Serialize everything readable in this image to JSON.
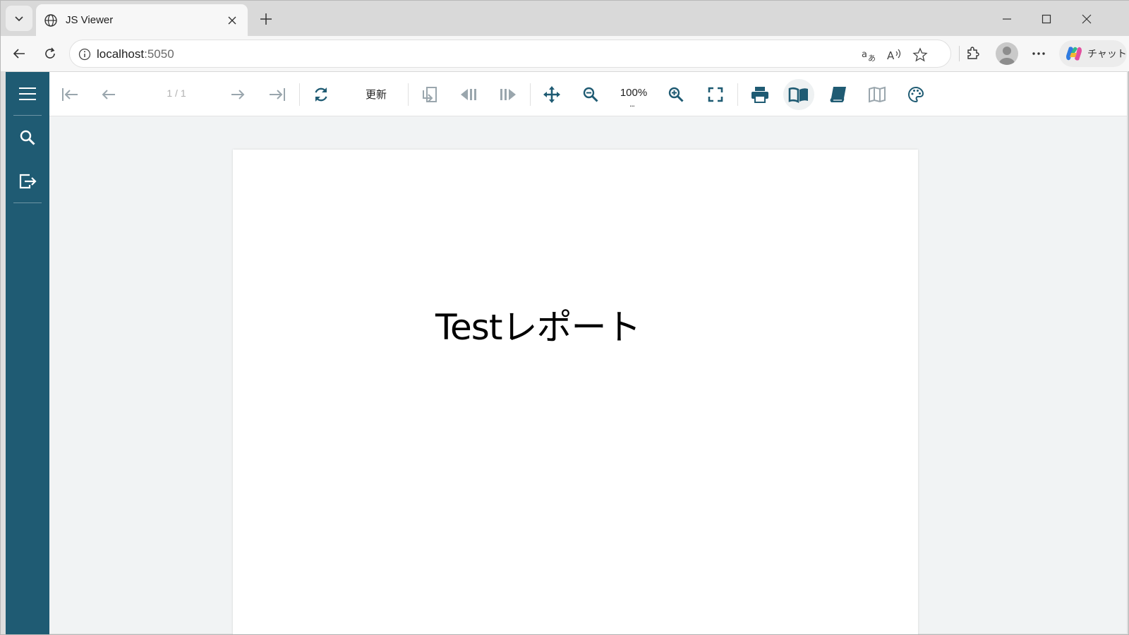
{
  "browser": {
    "tab_title": "JS Viewer",
    "url_host": "localhost",
    "url_port": ":5050",
    "copilot_label": "チャット",
    "icons": [
      "tab-list-icon",
      "globe-icon",
      "close-icon",
      "plus-icon",
      "minimize-icon",
      "maximize-icon",
      "window-close-icon",
      "back-icon",
      "reload-icon",
      "info-icon",
      "translate-icon",
      "read-aloud-icon",
      "favorite-icon",
      "extensions-icon",
      "profile-icon",
      "more-icon",
      "copilot-icon"
    ]
  },
  "viewer": {
    "sidebar_icons": [
      "menu-icon",
      "search-icon",
      "export-icon"
    ],
    "toolbar": {
      "page_indicator": "1 / 1",
      "refresh_label": "更新",
      "zoom_label": "100%",
      "zoom_more": "...",
      "icons": [
        "first-page-icon",
        "prev-page-icon",
        "next-page-icon",
        "last-page-icon",
        "refresh-icon",
        "back-to-parent-icon",
        "history-back-icon",
        "history-forward-icon",
        "pan-mode-icon",
        "zoom-out-icon",
        "zoom-in-icon",
        "fullscreen-icon",
        "print-icon",
        "single-page-view-icon",
        "continuous-view-icon",
        "galley-view-icon",
        "theme-icon"
      ]
    },
    "report": {
      "text": "Testレポート"
    }
  },
  "colors": {
    "sidebar": "#1f5b73",
    "toolbar_icon": "#1f5b73",
    "viewer_bg": "#f1f3f4"
  }
}
